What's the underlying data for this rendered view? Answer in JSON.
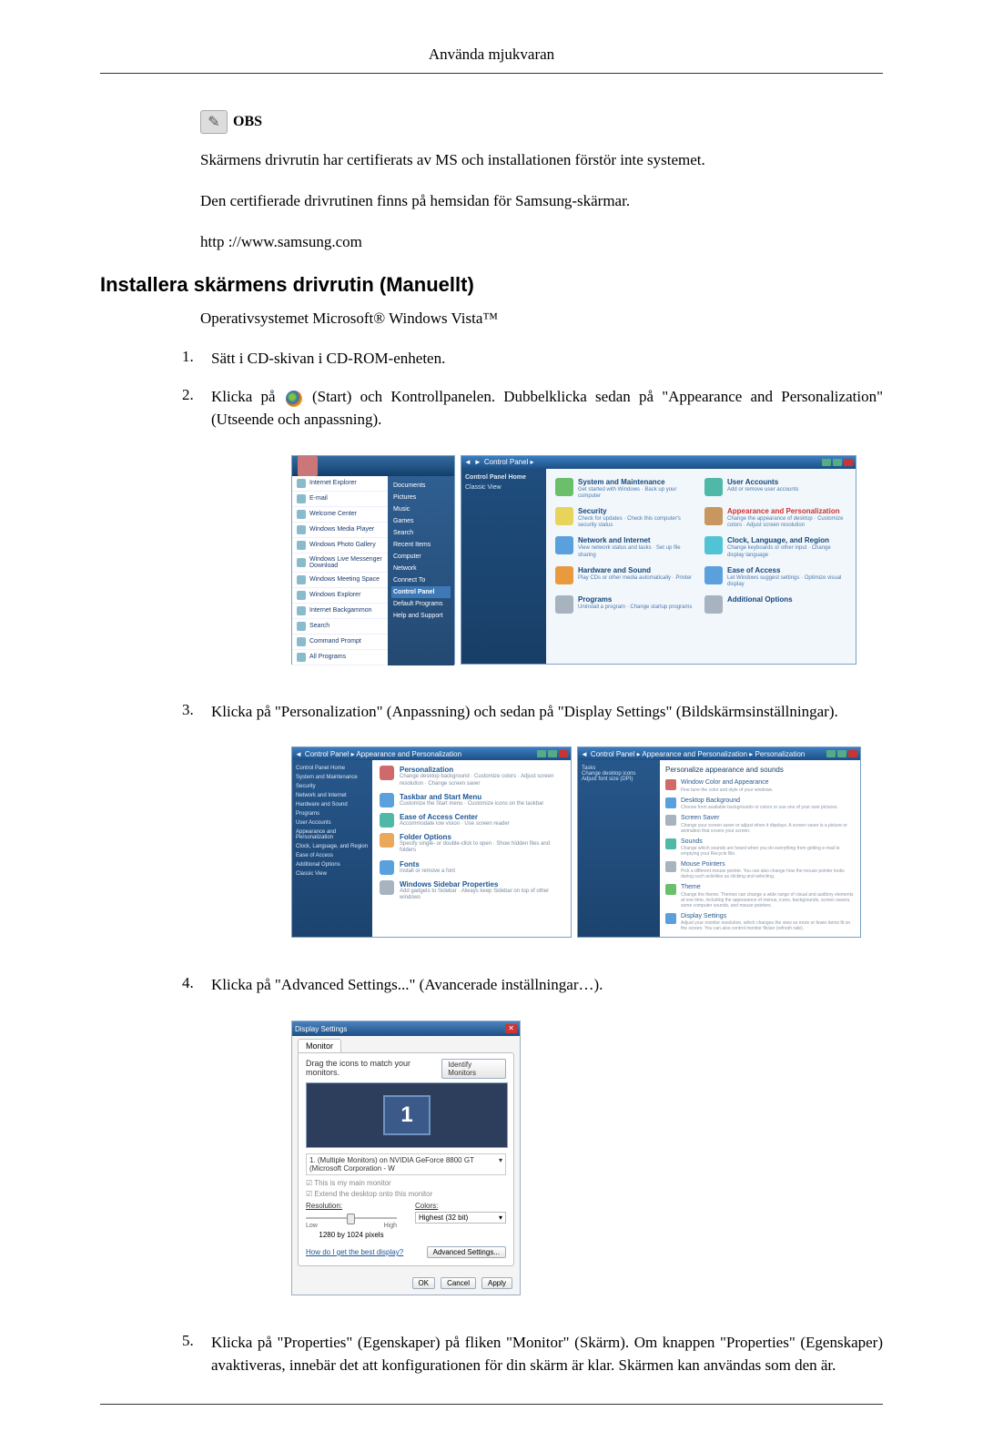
{
  "header_title": "Använda mjukvaran",
  "obs": {
    "label": "OBS",
    "lines": [
      "Skärmens drivrutin har certifierats av MS och installationen förstör inte systemet.",
      "Den certifierade drivrutinen finns på hemsidan för Samsung-skärmar.",
      "http ://www.samsung.com"
    ]
  },
  "section_heading": "Installera skärmens drivrutin (Manuellt)",
  "os_line": "Operativsystemet Microsoft® Windows Vista™",
  "steps": [
    {
      "n": "1.",
      "t": "Sätt i CD-skivan i CD-ROM-enheten."
    },
    {
      "n": "2.",
      "t_pre": "Klicka på ",
      "t_post": " (Start) och Kontrollpanelen. Dubbelklicka sedan på \"Appearance and Personalization\" (Utseende och anpassning)."
    },
    {
      "n": "3.",
      "t": "Klicka på \"Personalization\" (Anpassning) och sedan på \"Display Settings\" (Bildskärmsinställningar)."
    },
    {
      "n": "4.",
      "t": "Klicka på \"Advanced Settings...\" (Avancerade inställningar…)."
    },
    {
      "n": "5.",
      "t": "Klicka på \"Properties\" (Egenskaper) på fliken \"Monitor\" (Skärm). Om knappen \"Properties\" (Egenskaper) avaktiveras, innebär det att konfigurationen för din skärm är klar. Skärmen kan användas som den är."
    }
  ],
  "fig1": {
    "start_menu": {
      "left_items": [
        "Internet Explorer",
        "E-mail",
        "Welcome Center",
        "Windows Media Player",
        "Windows Photo Gallery",
        "Windows Live Messenger Download",
        "Windows Meeting Space",
        "Windows Explorer",
        "Internet Backgammon",
        "Search",
        "Command Prompt",
        "All Programs"
      ],
      "right_items": [
        "Documents",
        "Pictures",
        "Music",
        "Games",
        "Search",
        "Recent Items",
        "Computer",
        "Network",
        "Connect To",
        "Control Panel",
        "Default Programs",
        "Help and Support"
      ],
      "highlight": "Control Panel"
    },
    "control_panel": {
      "title": "Control Panel",
      "crumb": "Control Panel ▸",
      "side_header": "Control Panel Home",
      "side_link": "Classic View",
      "categories": [
        {
          "h": "System and Maintenance",
          "s": "Get started with Windows · Back up your computer"
        },
        {
          "h": "User Accounts",
          "s": "Add or remove user accounts"
        },
        {
          "h": "Security",
          "s": "Check for updates · Check this computer's security status"
        },
        {
          "h": "Appearance and Personalization",
          "hl": true,
          "s": "Change the appearance of desktop · Customize colors · Adjust screen resolution"
        },
        {
          "h": "Network and Internet",
          "s": "View network status and tasks · Set up file sharing"
        },
        {
          "h": "Clock, Language, and Region",
          "s": "Change keyboards or other input · Change display language"
        },
        {
          "h": "Hardware and Sound",
          "s": "Play CDs or other media automatically · Printer"
        },
        {
          "h": "Ease of Access",
          "s": "Let Windows suggest settings · Optimize visual display"
        },
        {
          "h": "Programs",
          "s": "Uninstall a program · Change startup programs"
        },
        {
          "h": "Additional Options",
          "s": ""
        }
      ]
    }
  },
  "fig2": {
    "left": {
      "crumb": "Control Panel ▸ Appearance and Personalization",
      "side_items": [
        "Control Panel Home",
        "System and Maintenance",
        "Security",
        "Network and Internet",
        "Hardware and Sound",
        "Programs",
        "User Accounts",
        "Appearance and Personalization",
        "Clock, Language, and Region",
        "Ease of Access",
        "Additional Options",
        "Classic View"
      ],
      "items": [
        {
          "h": "Personalization",
          "d": "Change desktop background · Customize colors · Adjust screen resolution · Change screen saver"
        },
        {
          "h": "Taskbar and Start Menu",
          "d": "Customize the Start menu · Customize icons on the taskbar"
        },
        {
          "h": "Ease of Access Center",
          "d": "Accommodate low vision · Use screen reader"
        },
        {
          "h": "Folder Options",
          "d": "Specify single- or double-click to open · Show hidden files and folders"
        },
        {
          "h": "Fonts",
          "d": "Install or remove a font"
        },
        {
          "h": "Windows Sidebar Properties",
          "d": "Add gadgets to Sidebar · Always keep Sidebar on top of other windows"
        }
      ]
    },
    "right": {
      "crumb": "Control Panel ▸ Appearance and Personalization ▸ Personalization",
      "heading": "Personalize appearance and sounds",
      "side_items": [
        "Tasks",
        "Change desktop icons",
        "Adjust font size (DPI)"
      ],
      "items": [
        {
          "h": "Window Color and Appearance",
          "d": "Fine tune the color and style of your windows."
        },
        {
          "h": "Desktop Background",
          "d": "Choose from available backgrounds or colors or use one of your own pictures."
        },
        {
          "h": "Screen Saver",
          "d": "Change your screen saver or adjust when it displays. A screen saver is a picture or animation that covers your screen."
        },
        {
          "h": "Sounds",
          "d": "Change which sounds are heard when you do everything from getting e-mail to emptying your Recycle Bin."
        },
        {
          "h": "Mouse Pointers",
          "d": "Pick a different mouse pointer. You can also change how the mouse pointer looks during such activities as clicking and selecting."
        },
        {
          "h": "Theme",
          "d": "Change the theme. Themes can change a wide range of visual and auditory elements at one time, including the appearance of menus, icons, backgrounds, screen savers, some computer sounds, and mouse pointers."
        },
        {
          "h": "Display Settings",
          "d": "Adjust your monitor resolution, which changes the view so more or fewer items fit on the screen. You can also control monitor flicker (refresh rate)."
        }
      ]
    }
  },
  "fig3": {
    "title": "Display Settings",
    "tab": "Monitor",
    "drag_label": "Drag the icons to match your monitors.",
    "identify_btn": "Identify Monitors",
    "monitor_number": "1",
    "dropdown": "1. (Multiple Monitors) on NVIDIA GeForce 8800 GT (Microsoft Corporation - W",
    "chk_main": "This is my main monitor",
    "chk_extend": "Extend the desktop onto this monitor",
    "resolution_label": "Resolution:",
    "res_low": "Low",
    "res_high": "High",
    "res_value": "1280 by 1024 pixels",
    "colors_label": "Colors:",
    "colors_value": "Highest (32 bit)",
    "help_link": "How do I get the best display?",
    "adv_btn": "Advanced Settings...",
    "ok": "OK",
    "cancel": "Cancel",
    "apply": "Apply"
  }
}
